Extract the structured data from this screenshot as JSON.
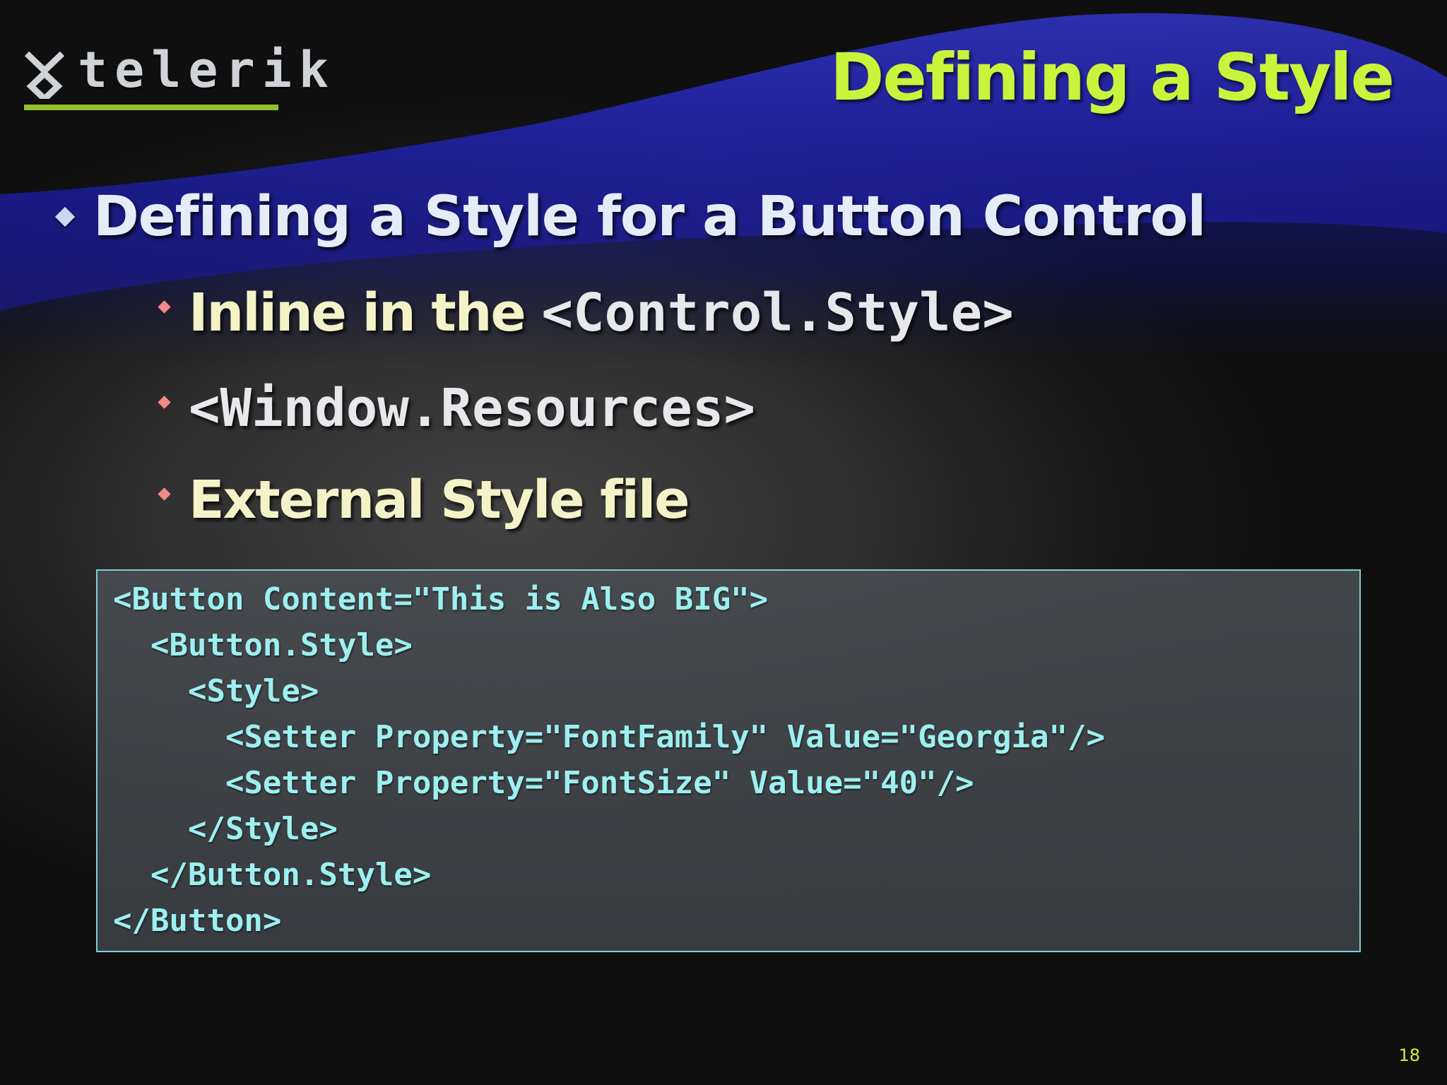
{
  "brand": {
    "logo_text": "telerik",
    "accent_color": "#93bf2d"
  },
  "title": "Defining a Style",
  "title_color": "#c8f43c",
  "bullets": {
    "level1": "Defining a Style for a Button Control",
    "level2": [
      {
        "prefix": "Inline in the ",
        "code": "<Control.Style>"
      },
      {
        "prefix": "",
        "code": "<Window.Resources>"
      },
      {
        "prefix": "External Style file",
        "code": ""
      }
    ]
  },
  "code": {
    "lines": [
      "<Button Content=\"This is Also BIG\">",
      "  <Button.Style>",
      "    <Style>",
      "      <Setter Property=\"FontFamily\" Value=\"Georgia\"/>",
      "      <Setter Property=\"FontSize\" Value=\"40\"/>",
      "    </Style>",
      "  </Button.Style>",
      "</Button>"
    ],
    "text_color": "#9deff0",
    "border_color": "#7fcfd8"
  },
  "page_number": "18"
}
